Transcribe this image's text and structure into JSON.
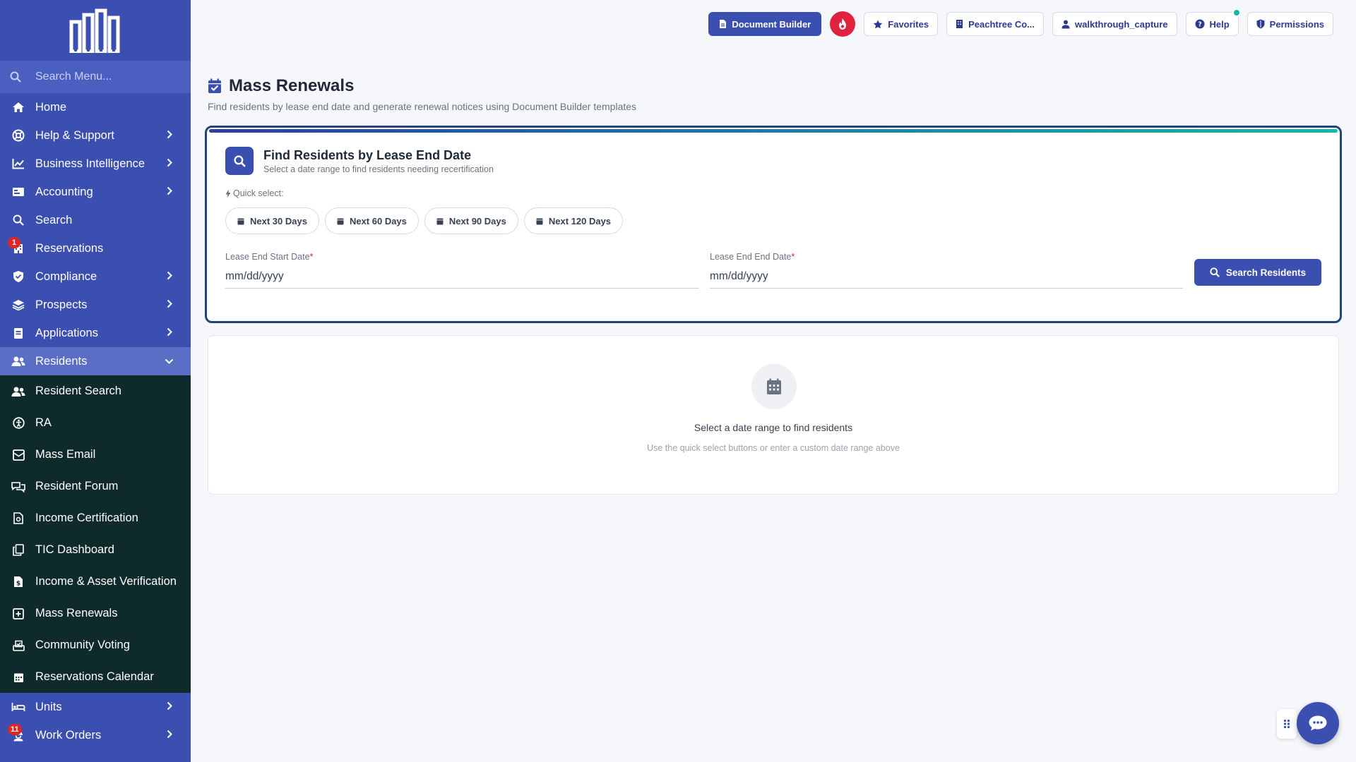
{
  "sidebar": {
    "search_placeholder": "Search Menu...",
    "items": [
      {
        "label": "Home",
        "icon": "home-icon"
      },
      {
        "label": "Help & Support",
        "icon": "lifebuoy-icon"
      },
      {
        "label": "Business Intelligence",
        "icon": "chart-line-icon"
      },
      {
        "label": "Accounting",
        "icon": "money-icon"
      },
      {
        "label": "Search",
        "icon": "search-icon"
      },
      {
        "label": "Reservations",
        "icon": "building-icon",
        "badge": "1"
      },
      {
        "label": "Compliance",
        "icon": "shield-icon"
      },
      {
        "label": "Prospects",
        "icon": "layers-icon"
      },
      {
        "label": "Applications",
        "icon": "file-icon"
      },
      {
        "label": "Residents",
        "icon": "users-icon"
      }
    ],
    "sub_items": [
      {
        "label": "Resident Search"
      },
      {
        "label": "RA"
      },
      {
        "label": "Mass Email"
      },
      {
        "label": "Resident Forum"
      },
      {
        "label": "Income Certification"
      },
      {
        "label": "TIC Dashboard"
      },
      {
        "label": "Income & Asset Verification"
      },
      {
        "label": "Mass Renewals"
      },
      {
        "label": "Community Voting"
      },
      {
        "label": "Reservations Calendar"
      }
    ],
    "bottom_items": [
      {
        "label": "Units"
      },
      {
        "label": "Work Orders",
        "badge": "11"
      }
    ]
  },
  "topbar": {
    "document_builder": "Document Builder",
    "favorites": "Favorites",
    "property": "Peachtree Co...",
    "user": "walkthrough_capture",
    "help": "Help",
    "permissions": "Permissions"
  },
  "page": {
    "title": "Mass Renewals",
    "subtitle": "Find residents by lease end date and generate renewal notices using Document Builder templates"
  },
  "search_card": {
    "title": "Find Residents by Lease End Date",
    "subtitle": "Select a date range to find residents needing recertification",
    "quick_select_label": "Quick select:",
    "chips": [
      "Next 30 Days",
      "Next 60 Days",
      "Next 90 Days",
      "Next 120 Days"
    ],
    "start_label": "Lease End Start Date",
    "end_label": "Lease End End Date",
    "required_mark": "*",
    "start_placeholder": "mm/dd/yyyy",
    "end_placeholder": "mm/dd/yyyy",
    "search_button": "Search Residents"
  },
  "empty_state": {
    "title": "Select a date range to find residents",
    "subtitle": "Use the quick select buttons or enter a custom date range above"
  },
  "colors": {
    "sidebar": "#3a4fb0",
    "sidebar_sub": "#0e2a2b",
    "accent": "#3a4fb0",
    "teal": "#14b8a6",
    "badge": "#e02424"
  }
}
